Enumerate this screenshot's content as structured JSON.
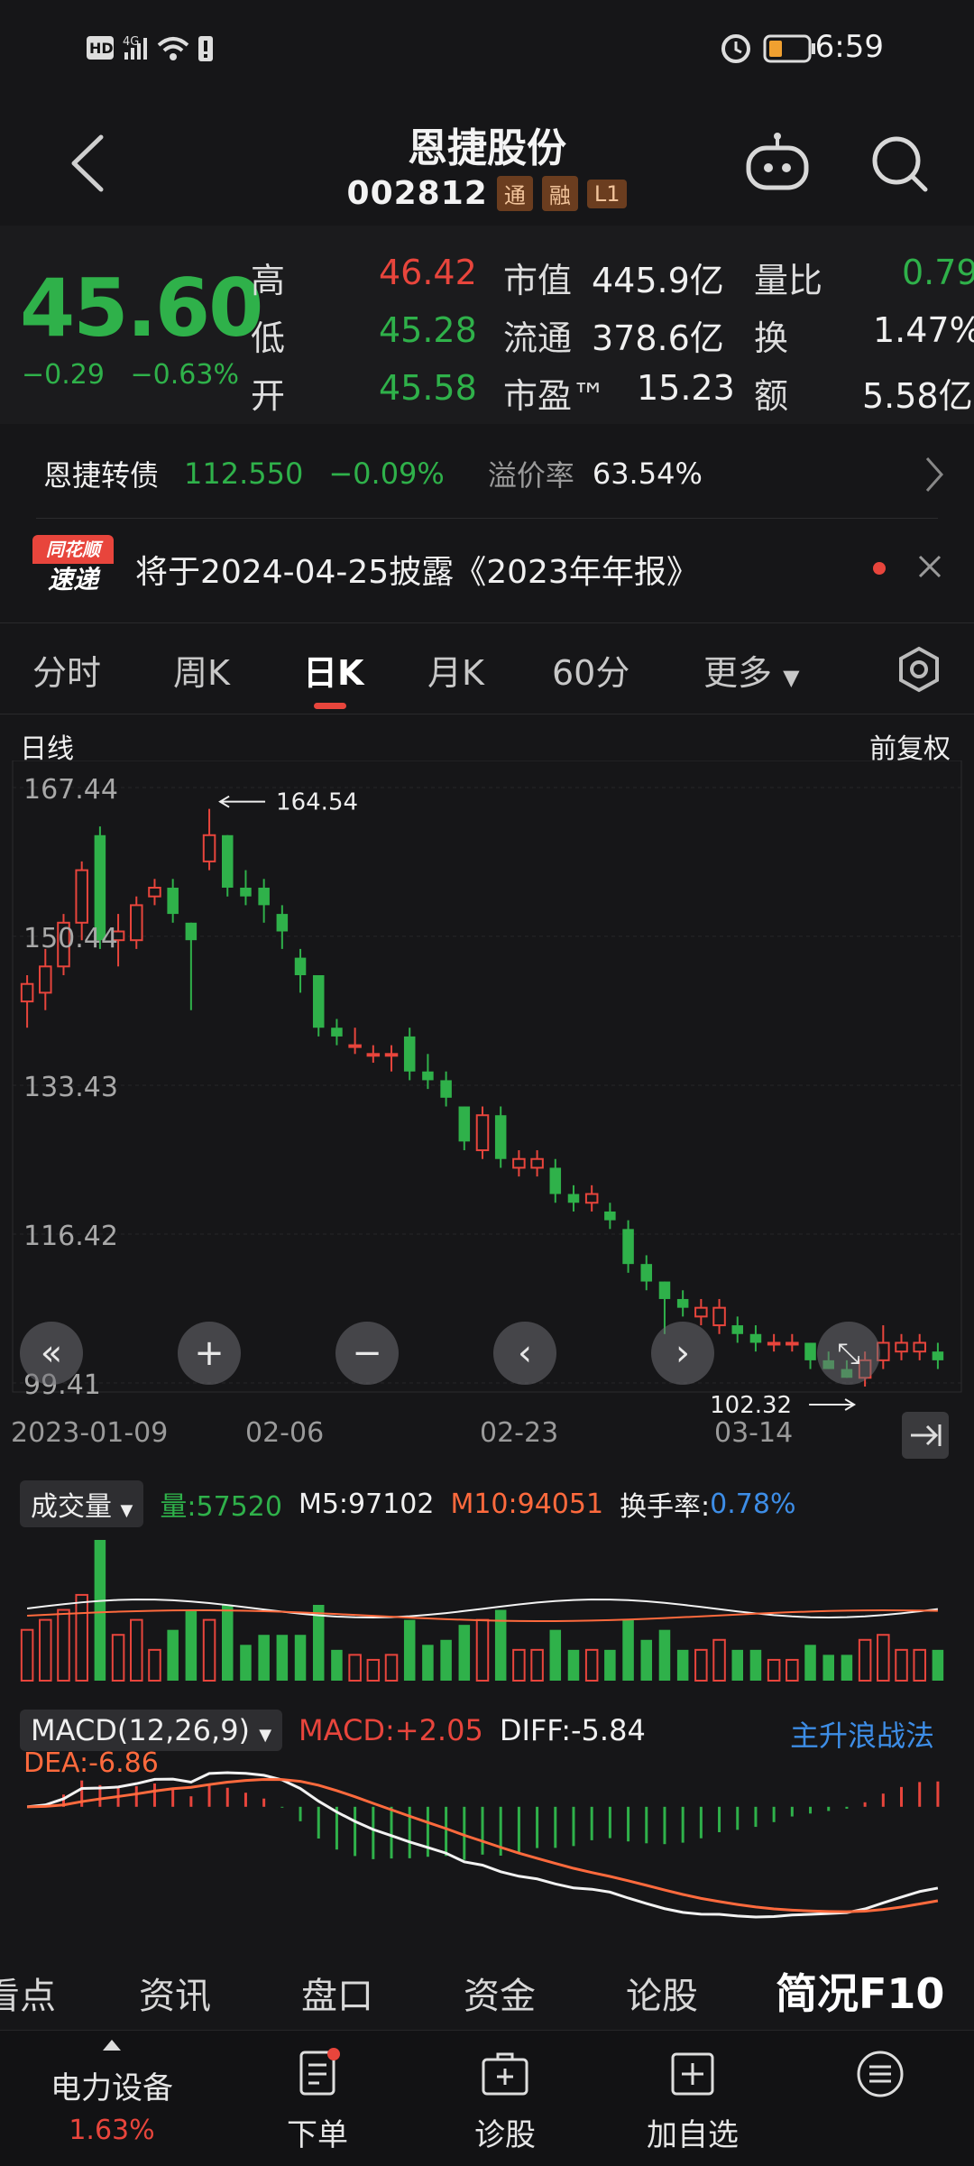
{
  "status_bar": {
    "left_icons": [
      "HD",
      "4G",
      "signal-icon",
      "wifi-icon",
      "alert-icon"
    ],
    "time": "6:59"
  },
  "header": {
    "title": "恩捷股份",
    "code": "002812",
    "tags": [
      "通",
      "融",
      "L1"
    ]
  },
  "quote": {
    "price": "45.60",
    "change": "−0.29",
    "change_pct": "−0.63%",
    "high_label": "高",
    "high": "46.42",
    "low_label": "低",
    "low": "45.28",
    "open_label": "开",
    "open": "45.58",
    "mktcap_label": "市值",
    "mktcap": "445.9亿",
    "float_label": "流通",
    "float": "378.6亿",
    "pe_label": "市盈™",
    "pe": "15.23",
    "volratio_label": "量比",
    "volratio": "0.79",
    "turnover_label": "换",
    "turnover": "1.47%",
    "amount_label": "额",
    "amount": "5.58亿"
  },
  "bond": {
    "name": "恩捷转债",
    "price": "112.550",
    "pct": "−0.09%",
    "premium_label": "溢价率",
    "premium": "63.54%"
  },
  "notice": {
    "badge_top": "同花顺",
    "badge_bottom": "速递",
    "text": "将于2024-04-25披露《2023年年报》"
  },
  "period_tabs": [
    "分时",
    "周K",
    "日K",
    "月K",
    "60分",
    "更多"
  ],
  "chart_header": {
    "left": "日线",
    "right": "前复权"
  },
  "kline": {
    "price_labels": [
      "167.44",
      "150.44",
      "133.43",
      "116.42",
      "99.41"
    ],
    "high_marker": "164.54",
    "low_marker": "102.32",
    "date_labels": [
      "2023-01-09",
      "02-06",
      "02-23",
      "03-14"
    ]
  },
  "volume": {
    "selector": "成交量",
    "vol_label": "量:57520",
    "m5_label": "M5:97102",
    "m10_label": "M10:94051",
    "turnover_label": "换手率:",
    "turnover_value": "0.78%"
  },
  "macd": {
    "selector": "MACD(12,26,9)",
    "macd_label": "MACD:+2.05",
    "diff_label": "DIFF:-5.84",
    "dea_label": "DEA:-6.86",
    "strategy_link": "主升浪战法"
  },
  "function_tabs": [
    "看点",
    "资讯",
    "盘口",
    "资金",
    "论股",
    "简况F10"
  ],
  "bottom_bar": {
    "sector_name": "电力设备",
    "sector_pct": "1.63%",
    "items": [
      "下单",
      "诊股",
      "加自选"
    ]
  },
  "chart_data": {
    "type": "candlestick",
    "interval": "daily",
    "y_range": [
      99.41,
      167.44
    ],
    "x_tick_labels": [
      "2023-01-09",
      "02-06",
      "02-23",
      "03-14"
    ],
    "annotations": [
      {
        "text": "164.54",
        "kind": "period-high"
      },
      {
        "text": "102.32",
        "kind": "period-low"
      }
    ],
    "candles": [
      {
        "o": 143,
        "h": 146,
        "l": 140,
        "c": 145
      },
      {
        "o": 144,
        "h": 149,
        "l": 142,
        "c": 147
      },
      {
        "o": 147,
        "h": 153,
        "l": 146,
        "c": 152
      },
      {
        "o": 152,
        "h": 159,
        "l": 150,
        "c": 158
      },
      {
        "o": 162,
        "h": 163,
        "l": 149,
        "c": 150
      },
      {
        "o": 150,
        "h": 153,
        "l": 147,
        "c": 151
      },
      {
        "o": 150,
        "h": 155,
        "l": 149,
        "c": 154
      },
      {
        "o": 155,
        "h": 157,
        "l": 154,
        "c": 156
      },
      {
        "o": 156,
        "h": 157,
        "l": 152,
        "c": 153
      },
      {
        "o": 152,
        "h": 152,
        "l": 142,
        "c": 150
      },
      {
        "o": 159,
        "h": 165,
        "l": 158,
        "c": 162
      },
      {
        "o": 162,
        "h": 162,
        "l": 155,
        "c": 156
      },
      {
        "o": 156,
        "h": 158,
        "l": 154,
        "c": 155
      },
      {
        "o": 156,
        "h": 157,
        "l": 152,
        "c": 154
      },
      {
        "o": 153,
        "h": 154,
        "l": 149,
        "c": 151
      },
      {
        "o": 148,
        "h": 149,
        "l": 144,
        "c": 146
      },
      {
        "o": 146,
        "h": 146,
        "l": 139,
        "c": 140
      },
      {
        "o": 140,
        "h": 141,
        "l": 138,
        "c": 139
      },
      {
        "o": 138,
        "h": 140,
        "l": 137,
        "c": 138
      },
      {
        "o": 137,
        "h": 138,
        "l": 136,
        "c": 137
      },
      {
        "o": 137,
        "h": 138,
        "l": 135,
        "c": 137
      },
      {
        "o": 139,
        "h": 140,
        "l": 134,
        "c": 135
      },
      {
        "o": 135,
        "h": 137,
        "l": 133,
        "c": 134
      },
      {
        "o": 134,
        "h": 135,
        "l": 131,
        "c": 132
      },
      {
        "o": 131,
        "h": 131,
        "l": 126,
        "c": 127
      },
      {
        "o": 126,
        "h": 131,
        "l": 125,
        "c": 130
      },
      {
        "o": 130,
        "h": 131,
        "l": 124,
        "c": 125
      },
      {
        "o": 124,
        "h": 126,
        "l": 123,
        "c": 125
      },
      {
        "o": 124,
        "h": 126,
        "l": 123,
        "c": 125
      },
      {
        "o": 124,
        "h": 125,
        "l": 120,
        "c": 121
      },
      {
        "o": 121,
        "h": 122,
        "l": 119,
        "c": 120
      },
      {
        "o": 120,
        "h": 122,
        "l": 119,
        "c": 121
      },
      {
        "o": 119,
        "h": 120,
        "l": 117,
        "c": 118
      },
      {
        "o": 117,
        "h": 118,
        "l": 112,
        "c": 113
      },
      {
        "o": 113,
        "h": 114,
        "l": 110,
        "c": 111
      },
      {
        "o": 111,
        "h": 111,
        "l": 105,
        "c": 109
      },
      {
        "o": 109,
        "h": 110,
        "l": 107,
        "c": 108
      },
      {
        "o": 107,
        "h": 109,
        "l": 106,
        "c": 108
      },
      {
        "o": 106,
        "h": 109,
        "l": 105,
        "c": 108
      },
      {
        "o": 106,
        "h": 107,
        "l": 104,
        "c": 105
      },
      {
        "o": 105,
        "h": 106,
        "l": 103,
        "c": 104
      },
      {
        "o": 104,
        "h": 105,
        "l": 103,
        "c": 104
      },
      {
        "o": 104,
        "h": 105,
        "l": 103,
        "c": 104
      },
      {
        "o": 104,
        "h": 104,
        "l": 101,
        "c": 102
      },
      {
        "o": 102,
        "h": 103,
        "l": 101,
        "c": 101
      },
      {
        "o": 101,
        "h": 102,
        "l": 100,
        "c": 100
      },
      {
        "o": 100,
        "h": 103,
        "l": 99,
        "c": 102
      },
      {
        "o": 102,
        "h": 106,
        "l": 101,
        "c": 104
      },
      {
        "o": 103,
        "h": 105,
        "l": 102,
        "c": 104
      },
      {
        "o": 103,
        "h": 105,
        "l": 102,
        "c": 104
      },
      {
        "o": 103,
        "h": 104,
        "l": 101,
        "c": 102
      }
    ]
  }
}
